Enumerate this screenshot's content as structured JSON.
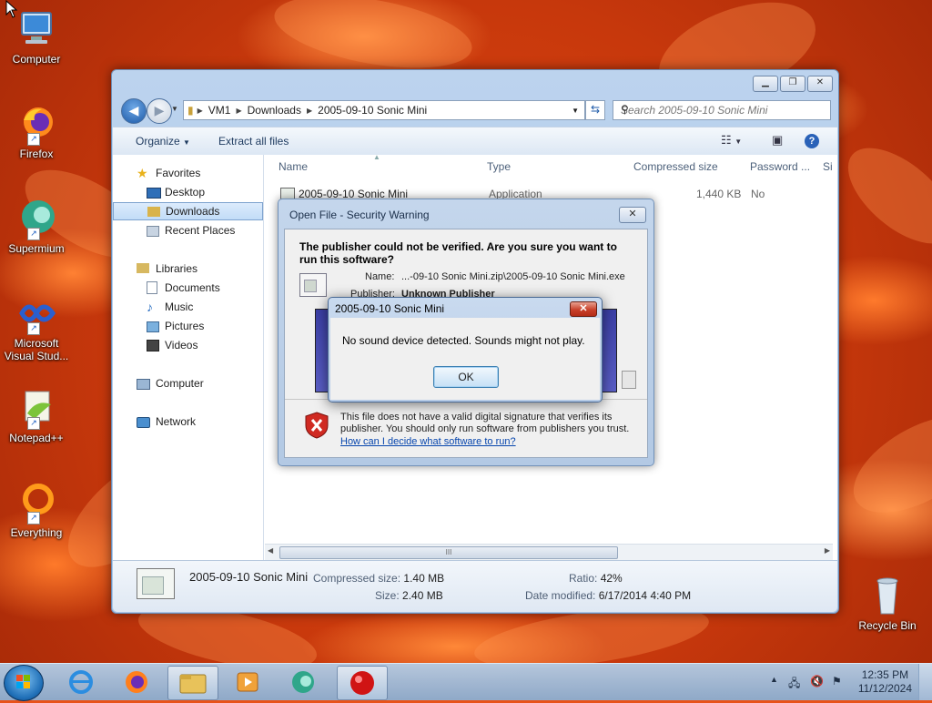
{
  "desktop": {
    "icons": [
      {
        "label": "Computer",
        "icon": "computer-icon"
      },
      {
        "label": "Firefox",
        "icon": "firefox-icon"
      },
      {
        "label": "Supermium",
        "icon": "supermium-icon"
      },
      {
        "label": "Microsoft Visual Stud...",
        "icon": "visual-studio-icon"
      },
      {
        "label": "Notepad++",
        "icon": "notepadpp-icon"
      },
      {
        "label": "Everything",
        "icon": "everything-icon"
      },
      {
        "label": "Recycle Bin",
        "icon": "recycle-bin-icon"
      }
    ]
  },
  "explorer": {
    "breadcrumb": [
      "VM1",
      "Downloads",
      "2005-09-10 Sonic Mini"
    ],
    "search_placeholder": "Search 2005-09-10 Sonic Mini",
    "toolbar": {
      "organize": "Organize",
      "extract": "Extract all files"
    },
    "nav": {
      "favorites": "Favorites",
      "desktop": "Desktop",
      "downloads": "Downloads",
      "recent": "Recent Places",
      "libraries": "Libraries",
      "documents": "Documents",
      "music": "Music",
      "pictures": "Pictures",
      "videos": "Videos",
      "computer": "Computer",
      "network": "Network"
    },
    "columns": {
      "name": "Name",
      "type": "Type",
      "compressed": "Compressed size",
      "password": "Password ...",
      "size": "Si"
    },
    "row": {
      "name": "2005-09-10 Sonic Mini",
      "type": "Application",
      "compressed": "1,440 KB",
      "password": "No"
    },
    "details": {
      "name": "2005-09-10 Sonic Mini",
      "compressed_key": "Compressed size:",
      "compressed_val": "1.40 MB",
      "size_key": "Size:",
      "size_val": "2.40 MB",
      "ratio_key": "Ratio:",
      "ratio_val": "42%",
      "date_key": "Date modified:",
      "date_val": "6/17/2014 4:40 PM"
    }
  },
  "security_warning": {
    "title": "Open File - Security Warning",
    "heading": "The publisher could not be verified.  Are you sure you want to run this software?",
    "name_key": "Name:",
    "name_val": "...-09-10 Sonic Mini.zip\\2005-09-10 Sonic Mini.exe",
    "publisher_key": "Publisher:",
    "publisher_val": "Unknown Publisher",
    "footer_text": "This file does not have a valid digital signature that verifies its publisher.  You should only run software from publishers you trust.",
    "footer_link": "How can I decide what software to run?"
  },
  "message_box": {
    "title": "2005-09-10 Sonic Mini",
    "message": "No sound device detected. Sounds might not play.",
    "ok": "OK"
  },
  "taskbar": {
    "time": "12:35 PM",
    "date": "11/12/2024"
  },
  "colors": {
    "accent": "#1d5aa8",
    "close_red": "#c8402a",
    "link": "#0645ad"
  }
}
